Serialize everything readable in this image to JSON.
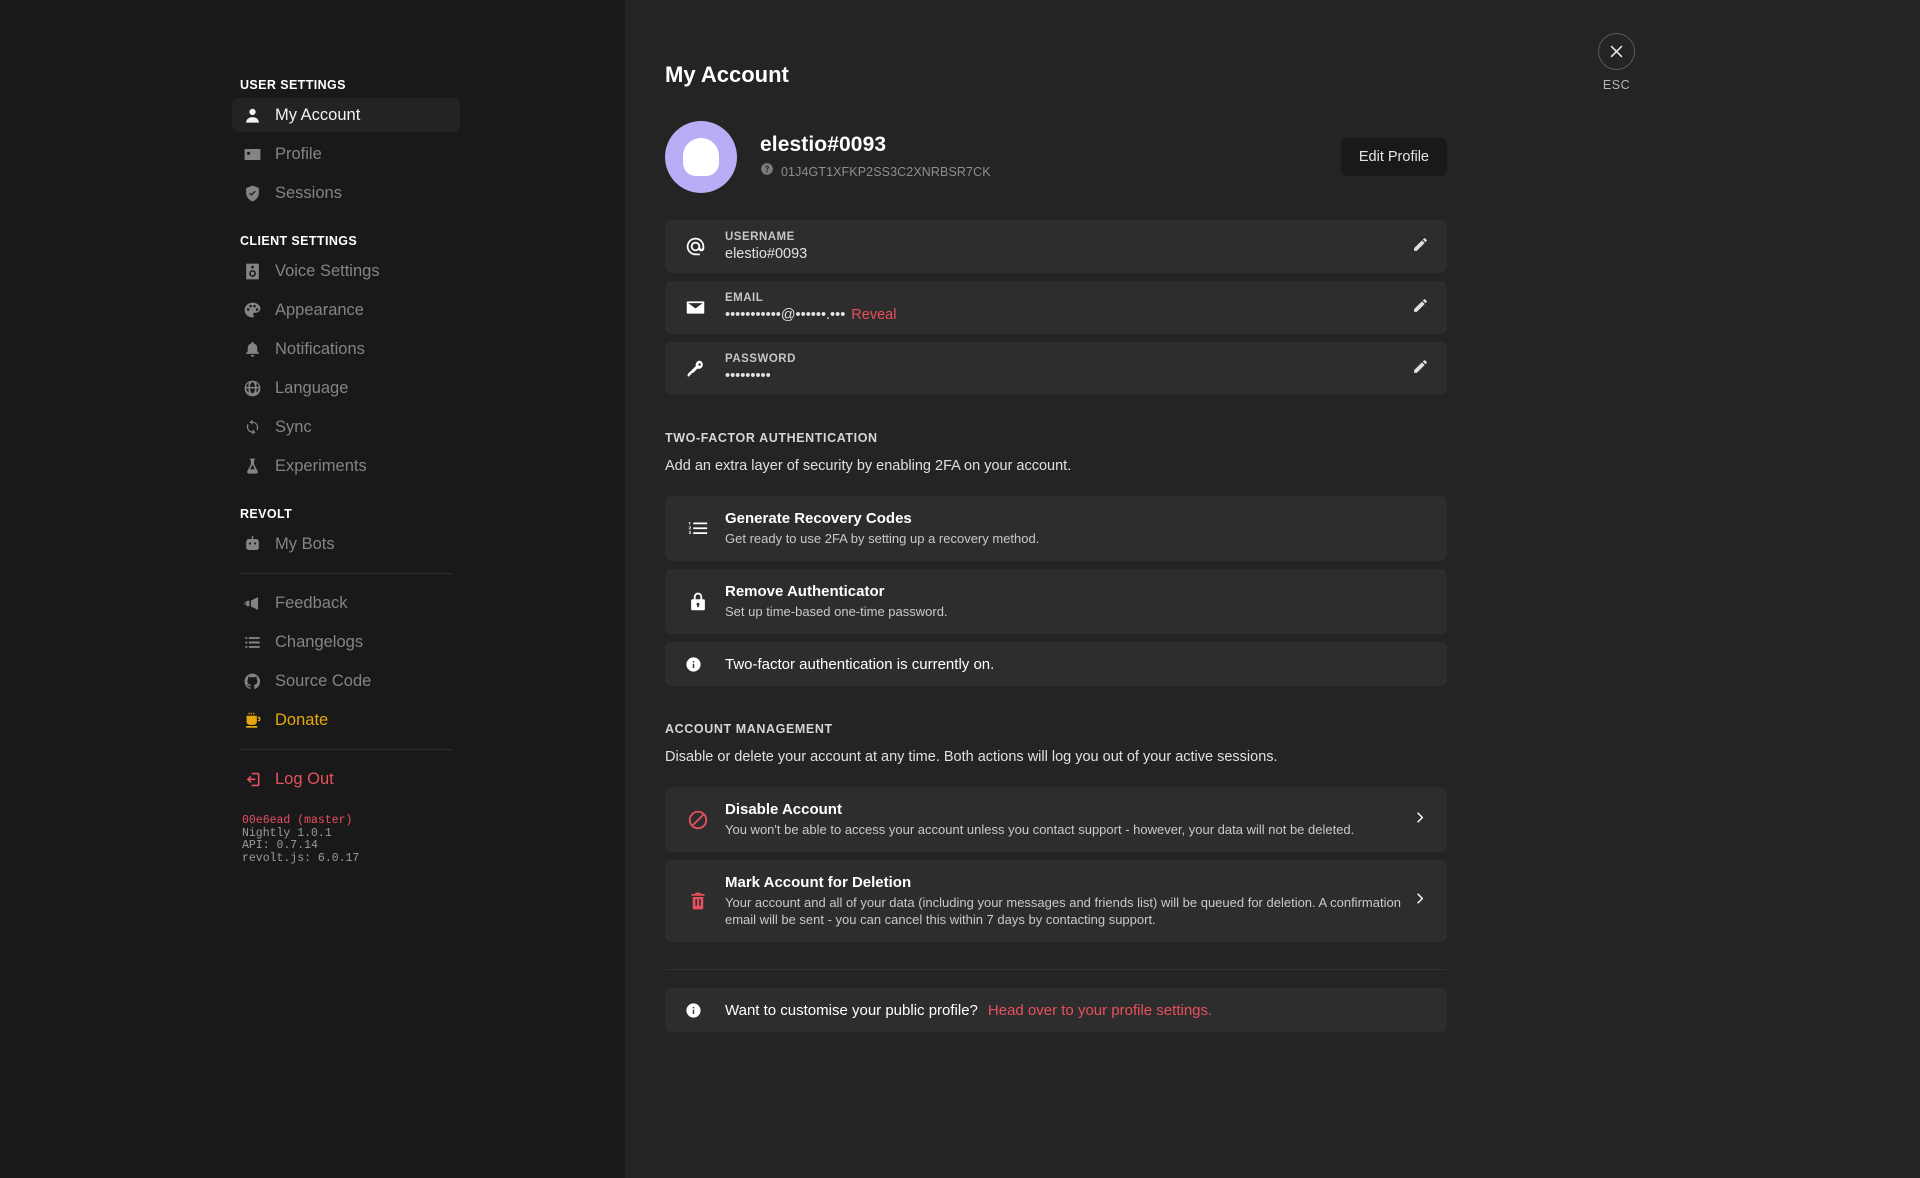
{
  "sidebar": {
    "groups": [
      {
        "title": "USER SETTINGS",
        "items": [
          {
            "label": "My Account",
            "icon": "user-icon",
            "active": true
          },
          {
            "label": "Profile",
            "icon": "id-card-icon",
            "active": false
          },
          {
            "label": "Sessions",
            "icon": "shield-check-icon",
            "active": false
          }
        ]
      },
      {
        "title": "CLIENT SETTINGS",
        "items": [
          {
            "label": "Voice Settings",
            "icon": "speaker-icon",
            "active": false
          },
          {
            "label": "Appearance",
            "icon": "palette-icon",
            "active": false
          },
          {
            "label": "Notifications",
            "icon": "bell-icon",
            "active": false
          },
          {
            "label": "Language",
            "icon": "globe-icon",
            "active": false
          },
          {
            "label": "Sync",
            "icon": "sync-icon",
            "active": false
          },
          {
            "label": "Experiments",
            "icon": "flask-icon",
            "active": false
          }
        ]
      },
      {
        "title": "REVOLT",
        "items": [
          {
            "label": "My Bots",
            "icon": "robot-icon",
            "active": false
          }
        ]
      }
    ],
    "links": [
      {
        "label": "Feedback",
        "icon": "megaphone-icon",
        "style": "normal"
      },
      {
        "label": "Changelogs",
        "icon": "list-icon",
        "style": "normal"
      },
      {
        "label": "Source Code",
        "icon": "github-icon",
        "style": "normal"
      },
      {
        "label": "Donate",
        "icon": "coffee-icon",
        "style": "donate"
      }
    ],
    "logout": {
      "label": "Log Out",
      "icon": "logout-icon"
    },
    "version": {
      "commit": "00e6ead (master)",
      "build": "Nightly 1.0.1",
      "api": "API: 0.7.14",
      "library": "revolt.js: 6.0.17"
    }
  },
  "header": {
    "title": "My Account",
    "username": "elestio#0093",
    "user_id": "01J4GT1XFKP2SS3C2XNRBSR7CK",
    "edit_profile_label": "Edit Profile"
  },
  "close": {
    "label": "ESC",
    "icon": "close-icon"
  },
  "fields": [
    {
      "icon": "at-icon",
      "label": "USERNAME",
      "value": "elestio#0093",
      "reveal": "",
      "edit_icon": "pencil-icon"
    },
    {
      "icon": "mail-icon",
      "label": "EMAIL",
      "value": "•••••••••••@••••••.•••",
      "reveal": "Reveal",
      "edit_icon": "pencil-icon"
    },
    {
      "icon": "key-icon",
      "label": "PASSWORD",
      "value": "•••••••••",
      "reveal": "",
      "edit_icon": "pencil-icon"
    }
  ],
  "two_factor": {
    "heading": "TWO-FACTOR AUTHENTICATION",
    "description": "Add an extra layer of security by enabling 2FA on your account.",
    "rows": [
      {
        "icon": "numbered-list-icon",
        "title": "Generate Recovery Codes",
        "desc": "Get ready to use 2FA by setting up a recovery method."
      },
      {
        "icon": "lock-icon",
        "title": "Remove Authenticator",
        "desc": "Set up time-based one-time password."
      }
    ],
    "status": {
      "icon": "info-icon",
      "text": "Two-factor authentication is currently on."
    }
  },
  "account_management": {
    "heading": "ACCOUNT MANAGEMENT",
    "description": "Disable or delete your account at any time. Both actions will log you out of your active sessions.",
    "rows": [
      {
        "icon": "ban-icon",
        "title": "Disable Account",
        "desc": "You won't be able to access your account unless you contact support - however, your data will not be deleted."
      },
      {
        "icon": "trash-icon",
        "title": "Mark Account for Deletion",
        "desc": "Your account and all of your data (including your messages and friends list) will be queued for deletion. A confirmation email will be sent - you can cancel this within 7 days by contacting support."
      }
    ]
  },
  "profile_notice": {
    "icon": "info-icon",
    "text": "Want to customise your public profile?",
    "link": "Head over to your profile settings."
  },
  "colors": {
    "page_bg": "#242424",
    "sidebar_bg": "#191919",
    "card_bg": "#2d2d2d",
    "accent_red": "#e8505f",
    "accent_gold": "#e5a70c",
    "avatar_bg": "#b9aef6"
  }
}
